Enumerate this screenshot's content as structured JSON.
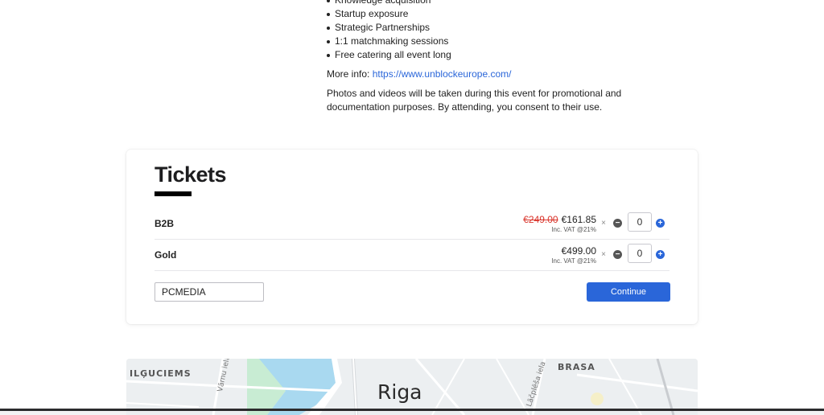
{
  "description": {
    "bullets": [
      "Knowledge acquisition",
      "Startup exposure",
      "Strategic Partnerships",
      "1:1 matchmaking sessions",
      "Free catering all event long"
    ],
    "more_info_label": "More info:",
    "more_info_link": "https://www.unblockeurope.com/",
    "notice": "Photos and videos will be taken during this event for promotional and documentation purposes. By attending, you consent to their use."
  },
  "tickets": {
    "title": "Tickets",
    "items": [
      {
        "name": "B2B",
        "old_price": "€249.00",
        "price": "€161.85",
        "vat": "Inc. VAT @21%",
        "multiplier": "×",
        "quantity": "0"
      },
      {
        "name": "Gold",
        "old_price": "",
        "price": "€499.00",
        "vat": "Inc. VAT @21%",
        "multiplier": "×",
        "quantity": "0"
      }
    ],
    "promo_code_value": "PCMEDIA",
    "continue_label": "Continue"
  },
  "map": {
    "labels": {
      "district_left": "ILĢUCIEMS",
      "district_right": "BRASA",
      "city": "Riga",
      "street_left": "Vārnu iela",
      "street_right": "Lāčplēša iela"
    }
  },
  "colors": {
    "accent": "#2a66d9",
    "old_price": "#d9342b"
  }
}
